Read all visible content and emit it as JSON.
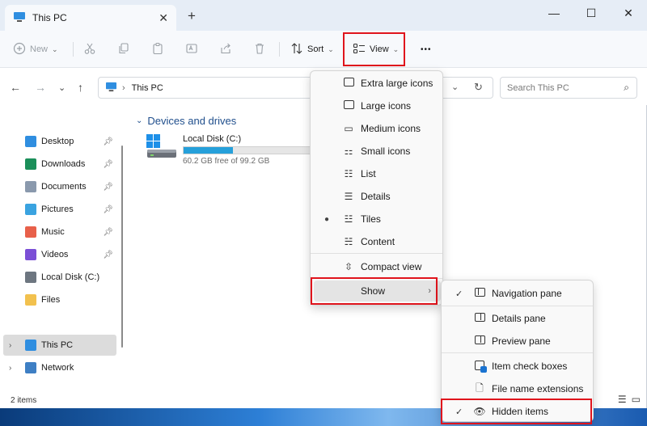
{
  "window": {
    "tab_title": "This PC",
    "new_tab_symbol": "+",
    "close_tab_symbol": "✕",
    "minimize_symbol": "—",
    "maximize_symbol": "☐",
    "close_symbol": "✕"
  },
  "toolbar": {
    "new_label": "New",
    "sort_label": "Sort",
    "view_label": "View",
    "more_symbol": "•••"
  },
  "address": {
    "path": "This PC",
    "search_placeholder": "Search This PC"
  },
  "sidebar": {
    "items": [
      {
        "label": "Desktop",
        "icon": "desktop-icon",
        "pinned": true
      },
      {
        "label": "Downloads",
        "icon": "downloads-icon",
        "pinned": true
      },
      {
        "label": "Documents",
        "icon": "documents-icon",
        "pinned": true
      },
      {
        "label": "Pictures",
        "icon": "pictures-icon",
        "pinned": true
      },
      {
        "label": "Music",
        "icon": "music-icon",
        "pinned": true
      },
      {
        "label": "Videos",
        "icon": "videos-icon",
        "pinned": true
      },
      {
        "label": "Local Disk (C:)",
        "icon": "drive-icon",
        "pinned": false
      },
      {
        "label": "Files",
        "icon": "folder-icon",
        "pinned": false
      },
      {
        "label": "This PC",
        "icon": "pc-icon",
        "selected": true
      },
      {
        "label": "Network",
        "icon": "network-icon"
      }
    ]
  },
  "content": {
    "section_title": "Devices and drives",
    "drive": {
      "name": "Local Disk (C:)",
      "free_text": "60.2 GB free of 99.2 GB",
      "used_fraction": 0.39
    }
  },
  "status": {
    "item_count": "2 items"
  },
  "view_menu": {
    "items": [
      {
        "label": "Extra large icons",
        "icon": "extra-large-icons-icon"
      },
      {
        "label": "Large icons",
        "icon": "large-icons-icon"
      },
      {
        "label": "Medium icons",
        "icon": "medium-icons-icon"
      },
      {
        "label": "Small icons",
        "icon": "small-icons-icon"
      },
      {
        "label": "List",
        "icon": "list-icon"
      },
      {
        "label": "Details",
        "icon": "details-icon"
      },
      {
        "label": "Tiles",
        "icon": "tiles-icon",
        "selected": true
      },
      {
        "label": "Content",
        "icon": "content-icon"
      },
      {
        "label": "Compact view",
        "icon": "compact-view-icon"
      },
      {
        "label": "Show",
        "has_submenu": true
      }
    ]
  },
  "show_menu": {
    "items": [
      {
        "label": "Navigation pane",
        "checked": true
      },
      {
        "label": "Details pane",
        "checked": false
      },
      {
        "label": "Preview pane",
        "checked": false
      },
      {
        "label": "Item check boxes",
        "checked": false
      },
      {
        "label": "File name extensions",
        "checked": false
      },
      {
        "label": "Hidden items",
        "checked": true
      }
    ]
  },
  "colors": {
    "accent": "#26a0da",
    "highlight_box": "#e0141c",
    "section_header": "#1f4e8c"
  }
}
